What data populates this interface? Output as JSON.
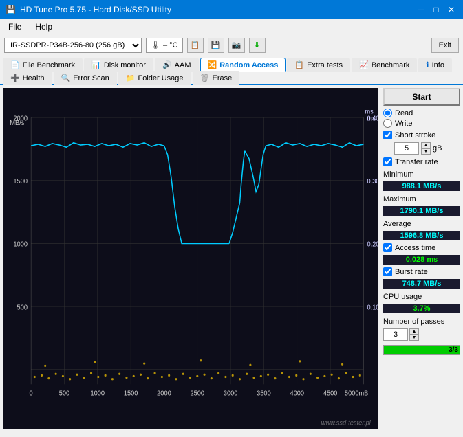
{
  "titleBar": {
    "title": "HD Tune Pro 5.75 - Hard Disk/SSD Utility",
    "minBtn": "─",
    "maxBtn": "□",
    "closeBtn": "✕"
  },
  "menuBar": {
    "items": [
      "File",
      "Help"
    ]
  },
  "toolbar": {
    "driveLabel": "IR-SSDPR-P34B-256-80 (256 gB)",
    "tempIcon": "🌡",
    "tempValue": "– °C",
    "exitLabel": "Exit"
  },
  "tabs": [
    {
      "id": "benchmark",
      "label": "Benchmark",
      "icon": "chart"
    },
    {
      "id": "file-benchmark",
      "label": "File Benchmark",
      "icon": "file"
    },
    {
      "id": "disk-monitor",
      "label": "Disk monitor",
      "icon": "monitor"
    },
    {
      "id": "aam",
      "label": "AAM",
      "icon": "sound"
    },
    {
      "id": "random-access",
      "label": "Random Access",
      "icon": "random",
      "active": true
    },
    {
      "id": "extra-tests",
      "label": "Extra tests",
      "icon": "extra"
    },
    {
      "id": "info",
      "label": "Info",
      "icon": "info"
    },
    {
      "id": "health",
      "label": "Health",
      "icon": "health"
    },
    {
      "id": "error-scan",
      "label": "Error Scan",
      "icon": "scan"
    },
    {
      "id": "folder-usage",
      "label": "Folder Usage",
      "icon": "folder"
    },
    {
      "id": "erase",
      "label": "Erase",
      "icon": "erase"
    }
  ],
  "chart": {
    "leftAxis": {
      "label": "MB/s",
      "max": 2000,
      "marks": [
        2000,
        1500,
        1000,
        500
      ]
    },
    "rightAxis": {
      "label": "ms",
      "max": 0.4,
      "marks": [
        0.4,
        0.3,
        0.2,
        0.1
      ]
    },
    "bottomAxis": {
      "marks": [
        0,
        500,
        1000,
        1500,
        2000,
        2500,
        3000,
        3500,
        4000,
        4500,
        "5000mB"
      ]
    }
  },
  "rightPanel": {
    "startLabel": "Start",
    "readLabel": "Read",
    "writeLabel": "Write",
    "shortStrokeLabel": "Short stroke",
    "shortStrokeValue": "5",
    "shortStrokeUnit": "gB",
    "transferRateLabel": "Transfer rate",
    "minimumLabel": "Minimum",
    "minimumValue": "988.1 MB/s",
    "maximumLabel": "Maximum",
    "maximumValue": "1790.1 MB/s",
    "averageLabel": "Average",
    "averageValue": "1596.8 MB/s",
    "accessTimeLabel": "Access time",
    "accessTimeChecked": true,
    "accessTimeValue": "0.028 ms",
    "burstRateLabel": "Burst rate",
    "burstRateChecked": true,
    "burstRateValue": "748.7 MB/s",
    "cpuUsageLabel": "CPU usage",
    "cpuUsageValue": "3.7%",
    "numberOfPassesLabel": "Number of passes",
    "numberOfPassesValue": "3",
    "progressLabel": "3/3",
    "progressPercent": 100
  },
  "watermark": "www.ssd-tester.pl"
}
